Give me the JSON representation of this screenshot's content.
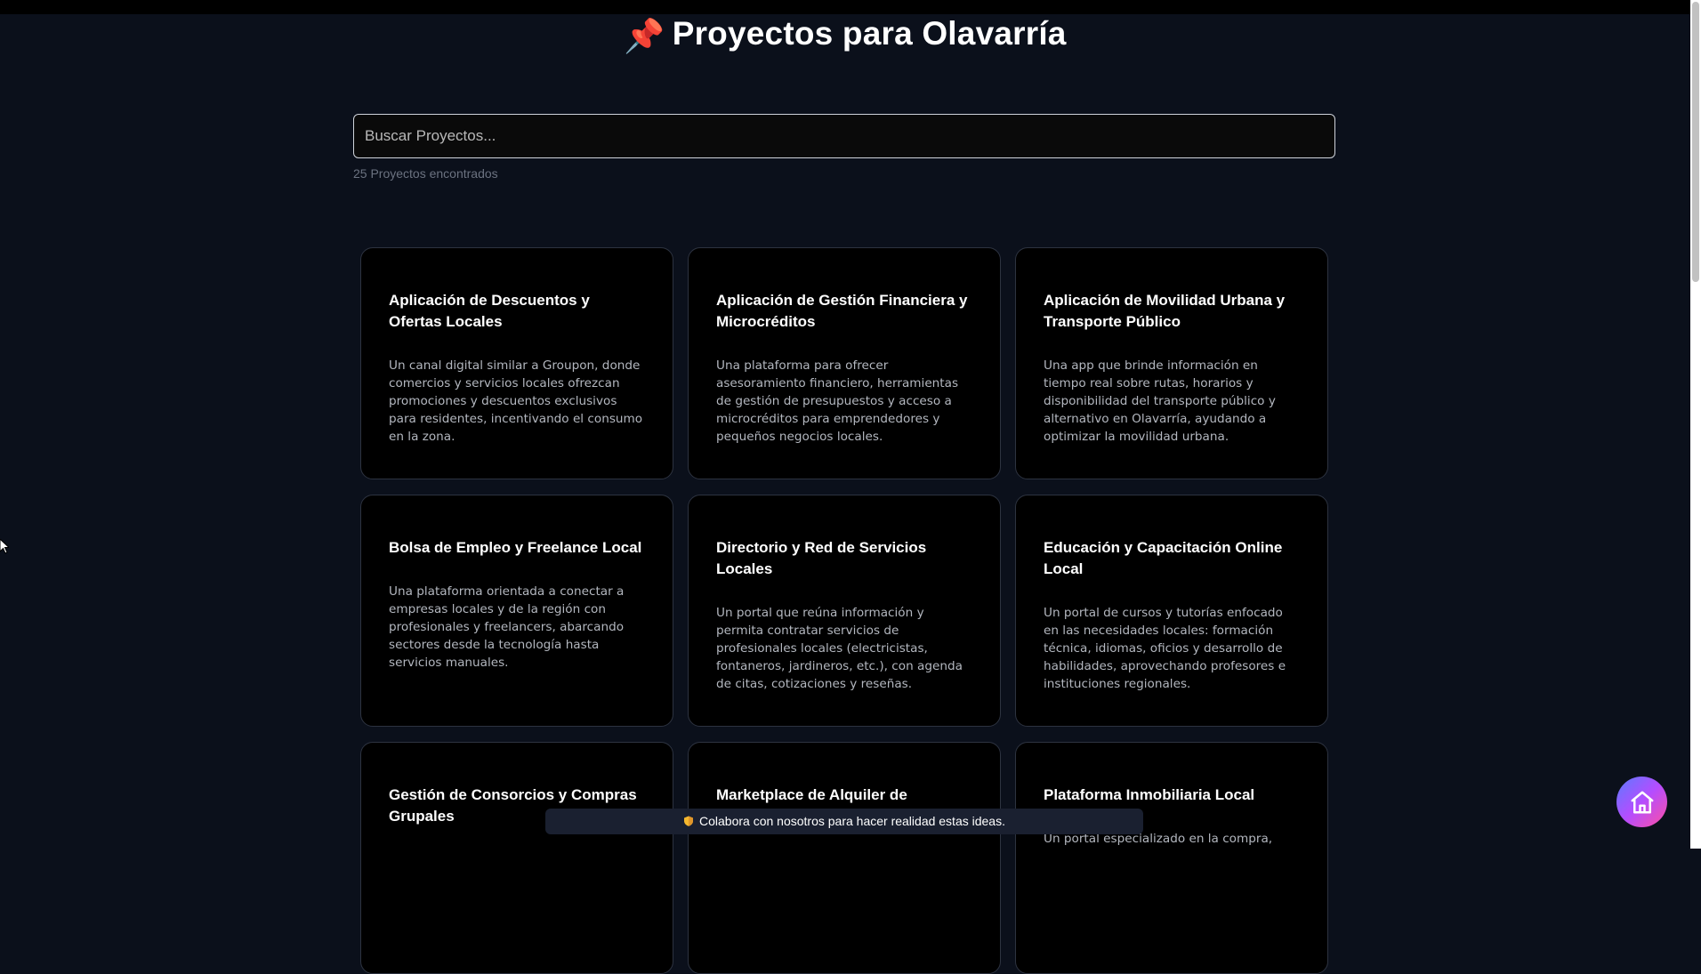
{
  "header": {
    "pin_icon": "📌",
    "title": "Proyectos para Olavarría"
  },
  "search": {
    "placeholder": "Buscar Proyectos...",
    "value": ""
  },
  "results": {
    "count_text": "25 Proyectos encontrados"
  },
  "cards": [
    {
      "title": "Aplicación de Descuentos y Ofertas Locales",
      "description": "Un canal digital similar a Groupon, donde comercios y servicios locales ofrezcan promociones y descuentos exclusivos para residentes, incentivando el consumo en la zona."
    },
    {
      "title": "Aplicación de Gestión Financiera y Microcréditos",
      "description": "Una plataforma para ofrecer asesoramiento financiero, herramientas de gestión de presupuestos y acceso a microcréditos para emprendedores y pequeños negocios locales."
    },
    {
      "title": "Aplicación de Movilidad Urbana y Transporte Público",
      "description": "Una app que brinde información en tiempo real sobre rutas, horarios y disponibilidad del transporte público y alternativo en Olavarría, ayudando a optimizar la movilidad urbana."
    },
    {
      "title": "Bolsa de Empleo y Freelance Local",
      "description": "Una plataforma orientada a conectar a empresas locales y de la región con profesionales y freelancers, abarcando sectores desde la tecnología hasta servicios manuales."
    },
    {
      "title": "Directorio y Red de Servicios Locales",
      "description": "Un portal que reúna información y permita contratar servicios de profesionales locales (electricistas, fontaneros, jardineros, etc.), con agenda de citas, cotizaciones y reseñas."
    },
    {
      "title": "Educación y Capacitación Online Local",
      "description": "Un portal de cursos y tutorías enfocado en las necesidades locales: formación técnica, idiomas, oficios y desarrollo de habilidades, aprovechando profesores e instituciones regionales."
    },
    {
      "title": "Gestión de Consorcios y Compras Grupales",
      "description": ""
    },
    {
      "title": "Marketplace de Alquiler de",
      "description": ""
    },
    {
      "title": "Plataforma Inmobiliaria Local",
      "description": "Un portal especializado en la compra,"
    }
  ],
  "banner": {
    "icon": "shield-icon",
    "text": "Colabora con nosotros para hacer realidad estas ideas."
  },
  "home_button": {
    "icon": "home-icon"
  }
}
